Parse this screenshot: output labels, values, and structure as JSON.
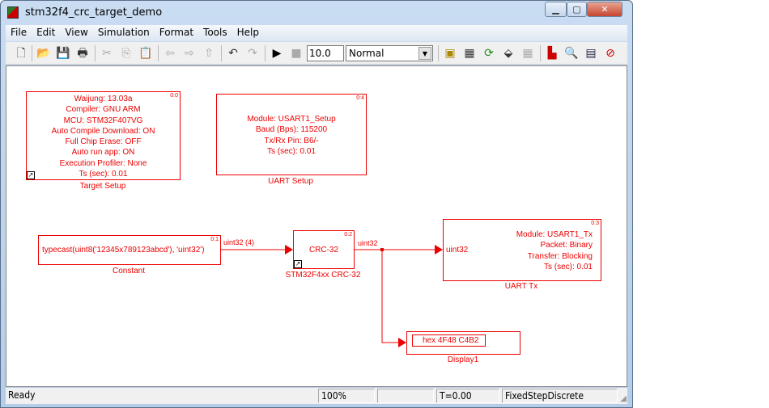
{
  "window": {
    "title": "stm32f4_crc_target_demo"
  },
  "menu": [
    "File",
    "Edit",
    "View",
    "Simulation",
    "Format",
    "Tools",
    "Help"
  ],
  "toolbar": {
    "stop_time": "10.0",
    "sim_mode": "Normal"
  },
  "blocks": {
    "target_setup": {
      "id": "0:0",
      "lines": [
        "Waijung: 13.03a",
        "Compiler: GNU ARM",
        "MCU: STM32F407VG",
        "Auto Compile Download: ON",
        "Full Chip Erase: OFF",
        "Auto run app: ON",
        "Execution Profiler: None",
        "Ts (sec): 0.01"
      ],
      "label": "Target Setup"
    },
    "uart_setup": {
      "id": "0:4",
      "lines": [
        "Module: USART1_Setup",
        "Baud (Bps): 115200",
        "Tx/Rx Pin: B6/-",
        "Ts (sec): 0.01"
      ],
      "label": "UART Setup"
    },
    "constant": {
      "id": "0:1",
      "text": "typecast(uint8('12345x789123abcd'), 'uint32')",
      "label": "Constant"
    },
    "crc": {
      "id": "0:2",
      "text": "CRC-32",
      "label": "STM32F4xx CRC-32"
    },
    "uart_tx": {
      "id": "0:3",
      "input": "uint32",
      "lines": [
        "Module: USART1_Tx",
        "Packet: Binary",
        "Transfer: Blocking",
        "Ts (sec): 0.01"
      ],
      "label": "UART Tx"
    },
    "display": {
      "value": "hex 4F48 C4B2",
      "label": "Display1"
    }
  },
  "signals": {
    "constant_out": "uint32 (4)",
    "crc_out": "uint32"
  },
  "status": {
    "state": "Ready",
    "zoom": "100%",
    "time": "T=0.00",
    "solver": "FixedStepDiscrete"
  }
}
